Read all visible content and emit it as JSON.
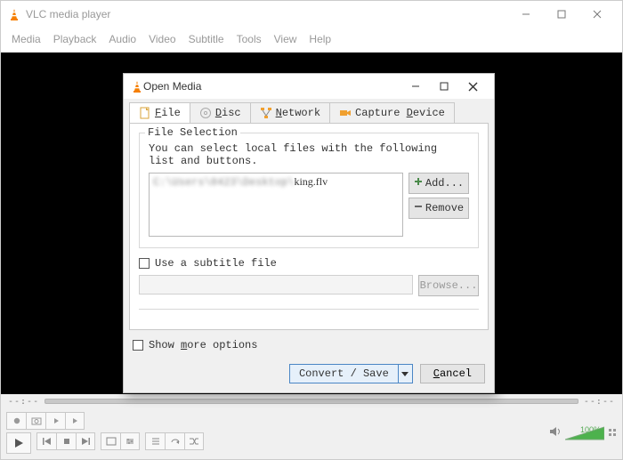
{
  "window": {
    "title": "VLC media player",
    "menus": [
      "Media",
      "Playback",
      "Audio",
      "Video",
      "Subtitle",
      "Tools",
      "View",
      "Help"
    ]
  },
  "scrubber": {
    "left_time": "--:--",
    "right_time": "--:--"
  },
  "volume": {
    "percent": "100%"
  },
  "dialog": {
    "title": "Open Media",
    "tabs": {
      "file": "File",
      "disc": "Disc",
      "network": "Network",
      "capture": "Capture Device"
    },
    "file_selection": {
      "legend": "File Selection",
      "help": "You can select local files with the following list and buttons.",
      "list_path_prefix": "C:\\Users\\0423\\Desktop\\",
      "list_filename": "king.flv",
      "add_label": "Add...",
      "remove_label": "Remove"
    },
    "subtitle": {
      "checkbox_label": "Use a subtitle file",
      "browse_label": "Browse..."
    },
    "more_options_label": "Show more options",
    "convert_label": "Convert / Save",
    "cancel_label": "Cancel"
  }
}
